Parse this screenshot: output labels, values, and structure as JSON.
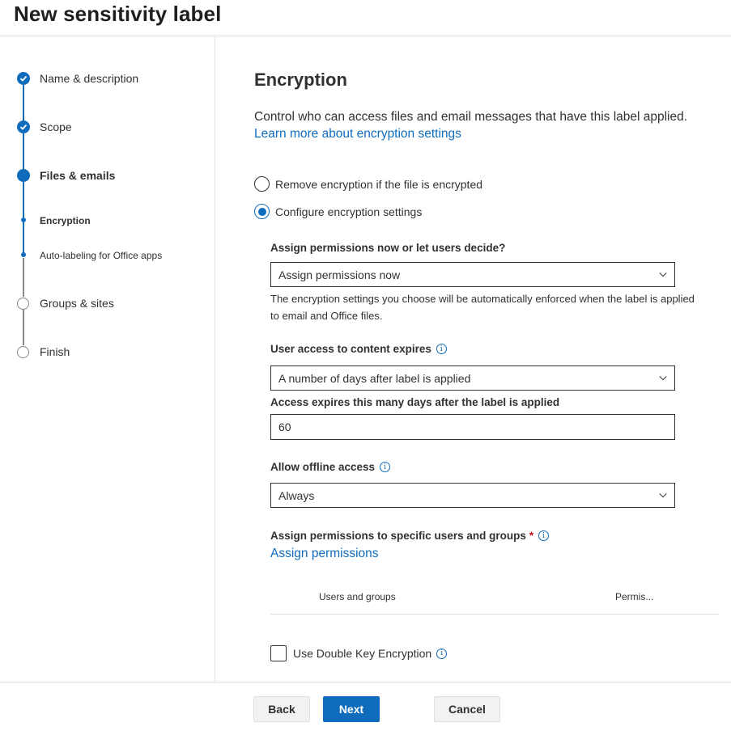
{
  "header": {
    "title": "New sensitivity label"
  },
  "stepper": {
    "steps": [
      {
        "label": "Name & description",
        "state": "completed",
        "icon": "checkmark-circle-icon"
      },
      {
        "label": "Scope",
        "state": "completed",
        "icon": "checkmark-circle-icon"
      },
      {
        "label": "Files & emails",
        "state": "current",
        "icon": "current-step-dot-icon"
      },
      {
        "label": "Encryption",
        "state": "current-substep",
        "icon": "substep-dot-icon"
      },
      {
        "label": "Auto-labeling for Office apps",
        "state": "substep",
        "icon": "substep-dot-icon"
      },
      {
        "label": "Groups & sites",
        "state": "pending",
        "icon": "empty-circle-icon"
      },
      {
        "label": "Finish",
        "state": "pending",
        "icon": "empty-circle-icon"
      }
    ]
  },
  "main": {
    "heading": "Encryption",
    "description": "Control who can access files and email messages that have this label applied.",
    "learn_more_link": "Learn more about encryption settings",
    "radio_options": [
      {
        "label": "Remove encryption if the file is encrypted",
        "selected": false
      },
      {
        "label": "Configure encryption settings",
        "selected": true
      }
    ],
    "assign_permissions_question": {
      "label": "Assign permissions now or let users decide?",
      "value": "Assign permissions now",
      "helper": "The encryption settings you choose will be automatically enforced when the label is applied to email and Office files."
    },
    "user_access_expires": {
      "label": "User access to content expires",
      "value": "A number of days after label is applied"
    },
    "access_expires_days": {
      "label": "Access expires this many days after the label is applied",
      "value": "60"
    },
    "offline_access": {
      "label": "Allow offline access",
      "value": "Always"
    },
    "specific_permissions": {
      "label": "Assign permissions to specific users and groups",
      "required_marker": "*",
      "link": "Assign permissions",
      "table_columns": [
        "Users and groups",
        "Permis..."
      ]
    },
    "double_key": {
      "label": "Use Double Key Encryption",
      "checked": false
    }
  },
  "footer": {
    "back": "Back",
    "next": "Next",
    "cancel": "Cancel"
  },
  "colors": {
    "accent": "#0f6cbd",
    "text": "#323130",
    "border": "#e1dfdd",
    "required": "#c50f1f"
  }
}
